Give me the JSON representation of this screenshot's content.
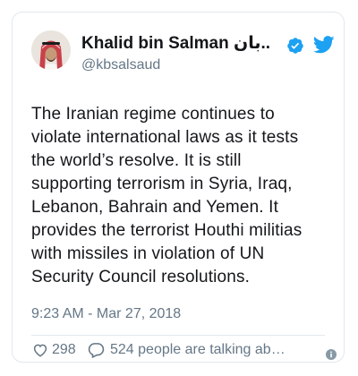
{
  "user": {
    "display_name": "Khalid bin Salman خالد بن سلمان",
    "display_name_shown": "Khalid bin Salman بان..",
    "handle": "@kbsalsaud"
  },
  "tweet": {
    "lines": [
      "The Iranian regime continues to",
      "violate international laws as it tests",
      "the world’s resolve. It is still",
      "supporting terrorism in Syria, Iraq,",
      "Lebanon, Bahrain and Yemen. It",
      "provides the terrorist Houthi militias",
      "with missiles in violation of UN",
      "Security Council resolutions."
    ],
    "timestamp": "9:23 AM - Mar 27, 2018"
  },
  "actions": {
    "like_count": "298",
    "talking_text": "524 people are talking ab…"
  },
  "colors": {
    "verified": "#1da1f2",
    "twitter_blue": "#1da1f2",
    "muted": "#657786",
    "border": "#e1e8ed"
  },
  "icons": {
    "verified": "verified-badge-icon",
    "bird": "twitter-bird-icon",
    "like": "heart-icon",
    "reply": "speech-bubble-icon",
    "info": "info-icon"
  }
}
